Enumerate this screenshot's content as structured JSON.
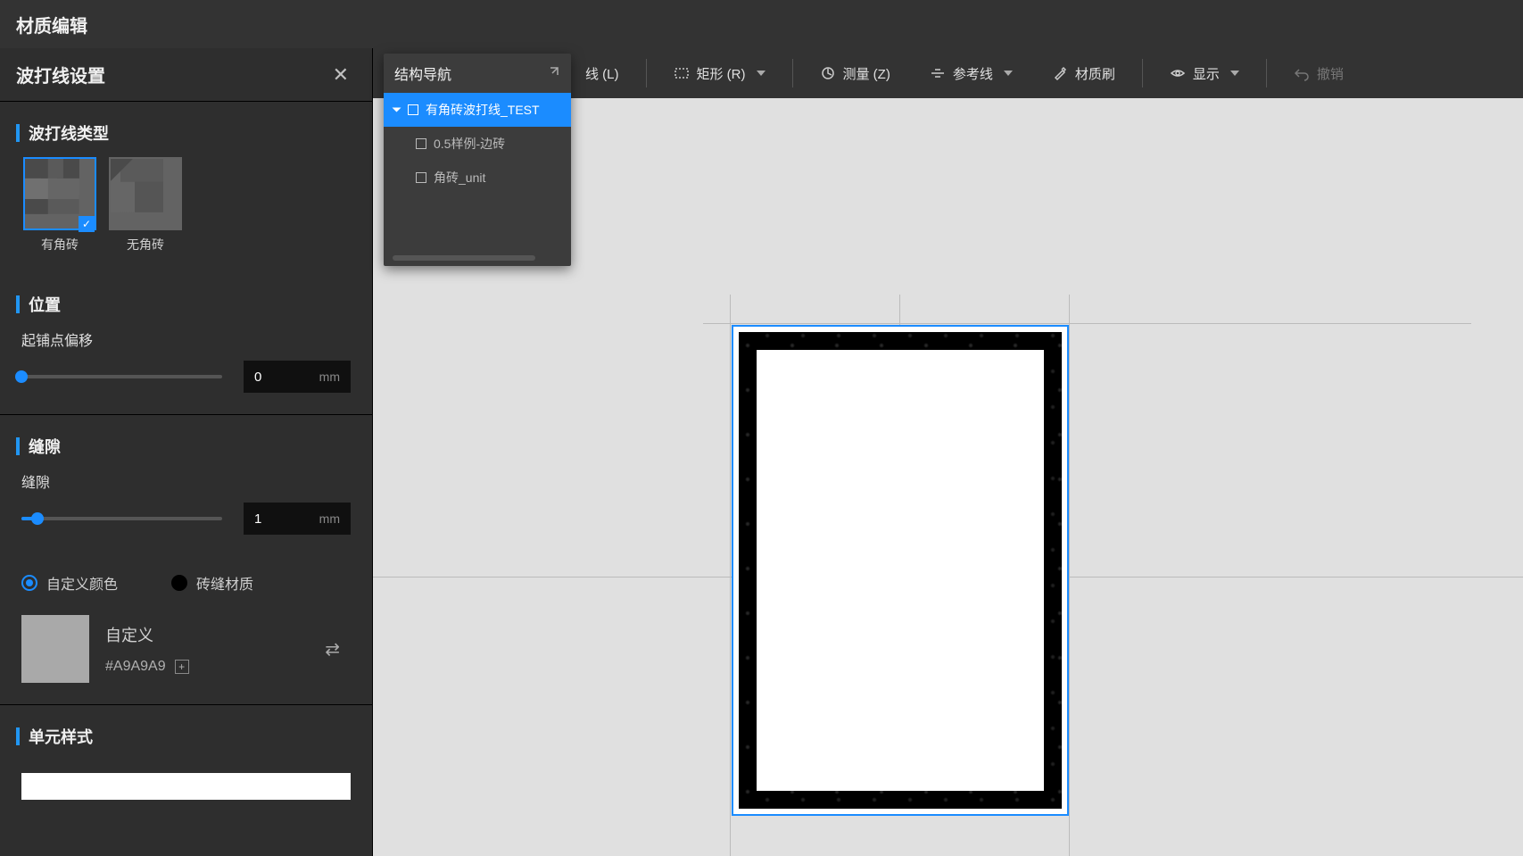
{
  "header": {
    "title": "材质编辑"
  },
  "panel": {
    "title": "波打线设置"
  },
  "sections": {
    "type": "波打线类型",
    "position": "位置",
    "gap": "缝隙",
    "unit": "单元样式"
  },
  "tileTypes": {
    "withCorner": "有角砖",
    "noCorner": "无角砖"
  },
  "position": {
    "offsetLabel": "起铺点偏移",
    "offsetValue": "0",
    "unit": "mm"
  },
  "gap": {
    "label": "缝隙",
    "value": "1",
    "unit": "mm",
    "radioCustomColor": "自定义颜色",
    "radioGroutMaterial": "砖缝材质",
    "swatchTitle": "自定义",
    "swatchHex": "#A9A9A9"
  },
  "structNav": {
    "title": "结构导航",
    "items": [
      {
        "label": "有角砖波打线_TEST",
        "active": true
      },
      {
        "label": "0.5样例-边砖",
        "active": false
      },
      {
        "label": "角砖_unit",
        "active": false
      }
    ]
  },
  "toolbar": {
    "lineTail": "线 (L)",
    "rect": "矩形 (R)",
    "measure": "测量 (Z)",
    "guide": "参考线",
    "brush": "材质刷",
    "display": "显示",
    "undo": "撤销"
  }
}
